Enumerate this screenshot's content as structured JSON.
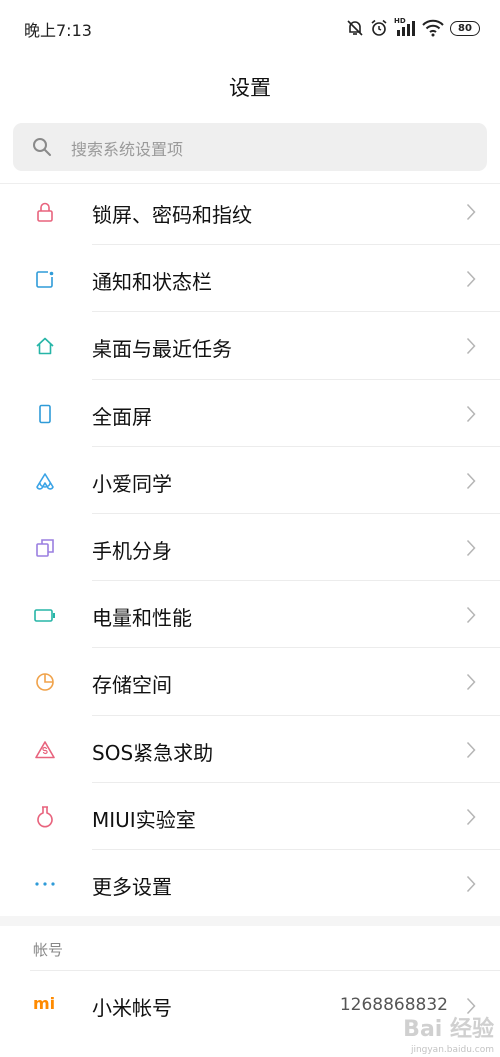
{
  "status_bar": {
    "time": "晚上7:13",
    "network_label": "HD",
    "battery": "80"
  },
  "page_title": "设置",
  "search": {
    "placeholder": "搜索系统设置项"
  },
  "settings_items": [
    {
      "label": "锁屏、密码和指纹",
      "icon": "lock-icon",
      "color": "#e8637d"
    },
    {
      "label": "通知和状态栏",
      "icon": "notification-icon",
      "color": "#2f9bd8"
    },
    {
      "label": "桌面与最近任务",
      "icon": "home-icon",
      "color": "#26b5a7"
    },
    {
      "label": "全面屏",
      "icon": "phone-screen-icon",
      "color": "#2f9bd8"
    },
    {
      "label": "小爱同学",
      "icon": "xiaoai-icon",
      "color": "#3aa3e6"
    },
    {
      "label": "手机分身",
      "icon": "second-space-icon",
      "color": "#9a7fe0"
    },
    {
      "label": "电量和性能",
      "icon": "battery-icon",
      "color": "#26b5a7"
    },
    {
      "label": "存储空间",
      "icon": "storage-pie-icon",
      "color": "#f0a24a"
    },
    {
      "label": "SOS紧急求助",
      "icon": "sos-icon",
      "color": "#e8637d"
    },
    {
      "label": "MIUI实验室",
      "icon": "lab-flask-icon",
      "color": "#e8637d"
    },
    {
      "label": "更多设置",
      "icon": "more-dots-icon",
      "color": "#2f9bd8"
    }
  ],
  "account_section": {
    "header": "帐号",
    "mi_account": {
      "label": "小米帐号",
      "value": "1268868832",
      "icon": "mi-logo-icon",
      "logo_text": "mi",
      "color": "#ff8a00"
    }
  },
  "watermark": {
    "text": "Bai 经验",
    "url": "jingyan.baidu.com"
  }
}
